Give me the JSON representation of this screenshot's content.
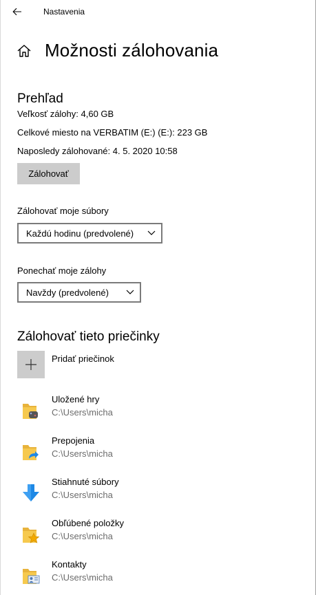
{
  "window": {
    "app_title": "Nastavenia"
  },
  "page": {
    "title": "Možnosti zálohovania"
  },
  "overview": {
    "heading": "Prehľad",
    "backup_size": "Veľkosť zálohy: 4,60 GB",
    "total_space": "Celkové miesto na VERBATIM (E:) (E:): 223 GB",
    "last_backup": "Naposledy zálohované: 4. 5. 2020 10:58",
    "backup_button": "Zálohovať"
  },
  "backup_frequency": {
    "label": "Zálohovať moje súbory",
    "selected": "Každú hodinu (predvolené)"
  },
  "keep_backups": {
    "label": "Ponechať moje zálohy",
    "selected": "Navždy (predvolené)"
  },
  "folders": {
    "heading": "Zálohovať tieto priečinky",
    "add_label": "Pridať priečinok",
    "items": [
      {
        "name": "Uložené hry",
        "path": "C:\\Users\\micha",
        "icon": "saved-games-folder-icon"
      },
      {
        "name": "Prepojenia",
        "path": "C:\\Users\\micha",
        "icon": "links-folder-icon"
      },
      {
        "name": "Stiahnuté súbory",
        "path": "C:\\Users\\micha",
        "icon": "downloads-arrow-icon"
      },
      {
        "name": "Obľúbené položky",
        "path": "C:\\Users\\micha",
        "icon": "favorites-folder-icon"
      },
      {
        "name": "Kontakty",
        "path": "C:\\Users\\micha",
        "icon": "contacts-folder-icon"
      }
    ]
  },
  "colors": {
    "button_gray": "#cccccc",
    "path_gray": "#6b6b6b",
    "download_blue": "#1e88e5",
    "folder_yellow": "#f6c94e"
  }
}
